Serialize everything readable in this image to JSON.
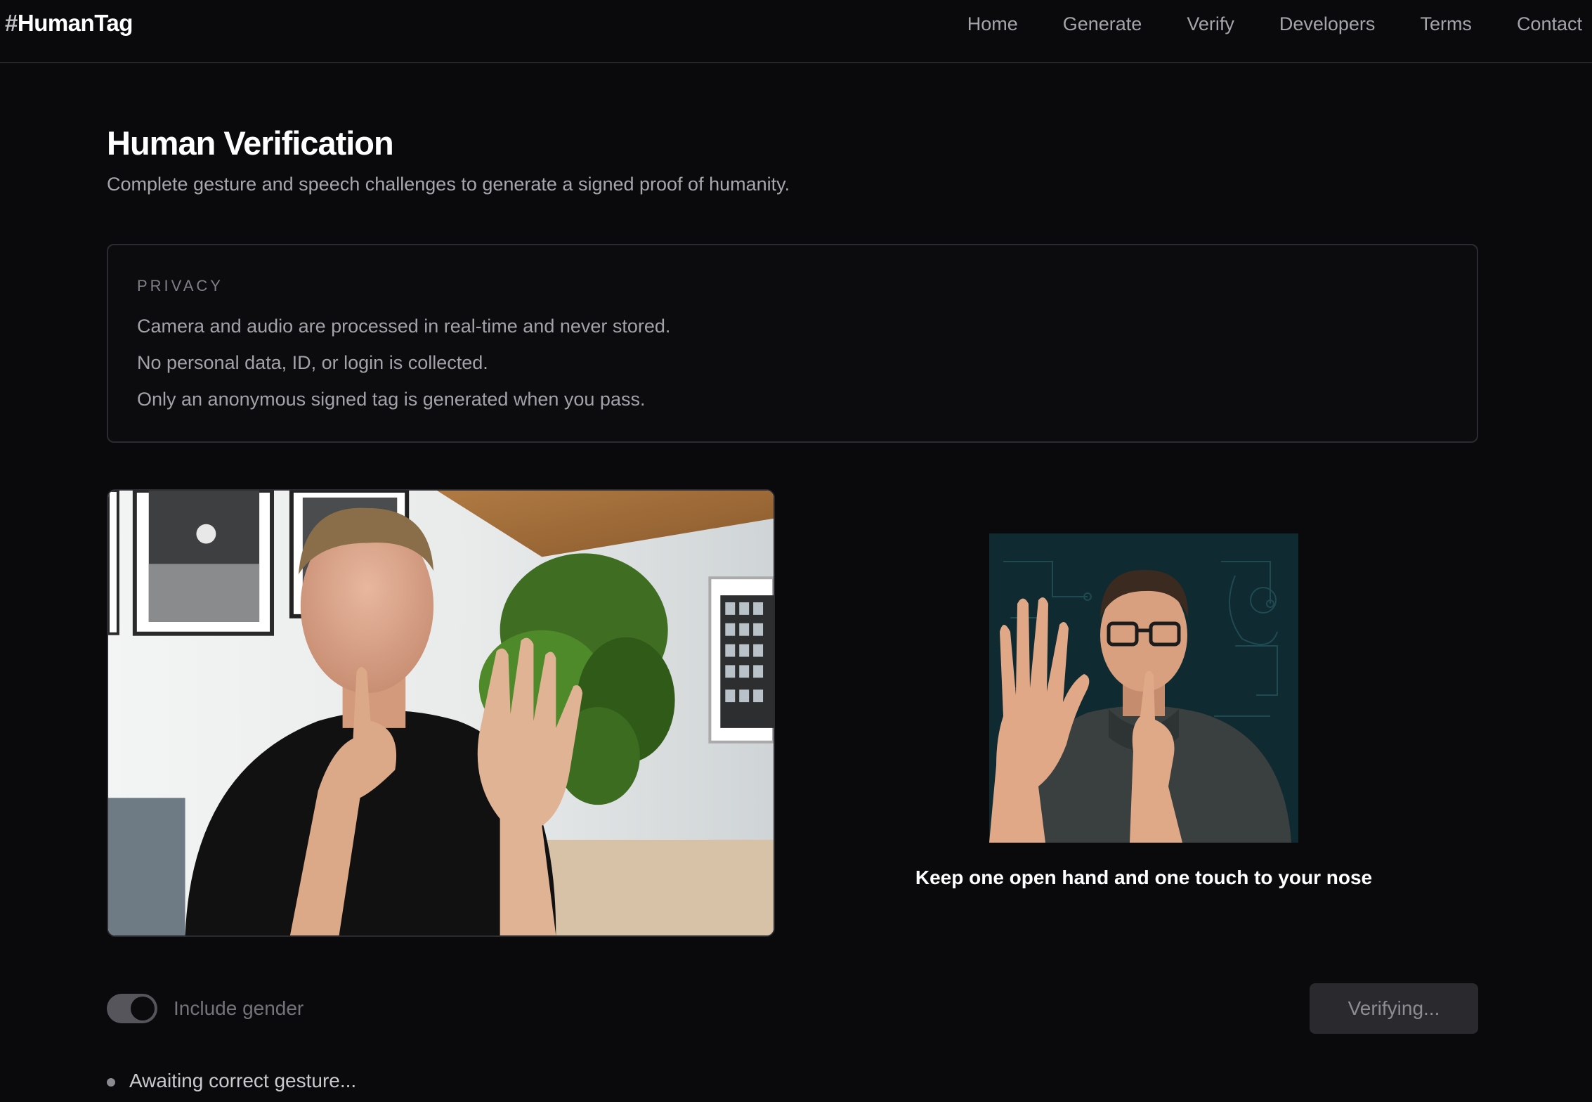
{
  "brand": {
    "hash": "#",
    "name": "HumanTag"
  },
  "nav": {
    "items": [
      "Home",
      "Generate",
      "Verify",
      "Developers",
      "Terms",
      "Contact"
    ]
  },
  "page": {
    "title": "Human Verification",
    "subtitle": "Complete gesture and speech challenges to generate a signed proof of humanity."
  },
  "privacy": {
    "label": "PRIVACY",
    "lines": [
      "Camera and audio are processed in real-time and never stored.",
      "No personal data, ID, or login is collected.",
      "Only an anonymous signed tag is generated when you pass."
    ]
  },
  "challenge": {
    "instruction": "Keep one open hand and one touch to your nose"
  },
  "controls": {
    "gender_toggle_label": "Include gender",
    "gender_toggle_on": true,
    "verify_button_label": "Verifying..."
  },
  "status": {
    "text": "Awaiting correct gesture..."
  },
  "colors": {
    "background": "#0a0a0c",
    "border": "#2b2b31",
    "reference_bg": "#0f2a30"
  }
}
